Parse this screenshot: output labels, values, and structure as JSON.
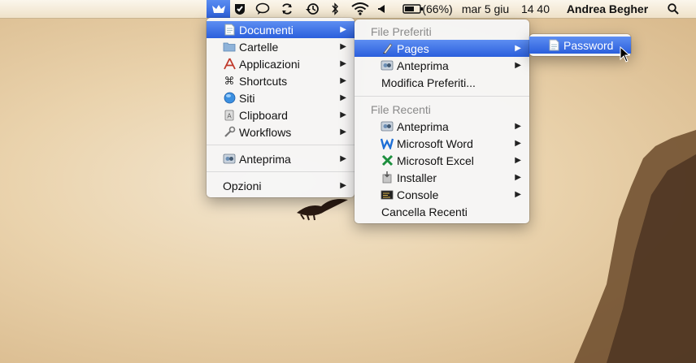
{
  "menubar": {
    "battery": "(66%)",
    "date": "mar 5 giu",
    "time": "14 40",
    "user": "Andrea Begher",
    "icons": [
      "app-launcher-icon",
      "checkmark-shield-icon",
      "chat-bubble-icon",
      "sync-icon",
      "time-machine-icon",
      "bluetooth-icon",
      "wifi-icon",
      "volume-icon",
      "battery-icon",
      "spotlight-search-icon"
    ]
  },
  "menu1": {
    "items": [
      {
        "label": "Documenti",
        "icon": "document-icon"
      },
      {
        "label": "Cartelle",
        "icon": "folder-icon"
      },
      {
        "label": "Applicazioni",
        "icon": "applications-icon"
      },
      {
        "label": "Shortcuts",
        "icon": "command-icon"
      },
      {
        "label": "Siti",
        "icon": "globe-icon"
      },
      {
        "label": "Clipboard",
        "icon": "clipboard-icon"
      },
      {
        "label": "Workflows",
        "icon": "wrench-icon"
      }
    ],
    "preview": "Anteprima",
    "options": "Opzioni"
  },
  "menu2": {
    "favorites_header": "File Preferiti",
    "favorites": [
      {
        "label": "Pages",
        "icon": "pages-icon"
      },
      {
        "label": "Anteprima",
        "icon": "preview-icon"
      }
    ],
    "edit_favorites": "Modifica Preferiti...",
    "recent_header": "File Recenti",
    "recent": [
      {
        "label": "Anteprima",
        "icon": "preview-icon"
      },
      {
        "label": "Microsoft Word",
        "icon": "word-icon"
      },
      {
        "label": "Microsoft Excel",
        "icon": "excel-icon"
      },
      {
        "label": "Installer",
        "icon": "installer-icon"
      },
      {
        "label": "Console",
        "icon": "console-icon"
      }
    ],
    "clear_recent": "Cancella Recenti"
  },
  "menu3": {
    "items": [
      {
        "label": "Password",
        "icon": "pages-document-icon"
      }
    ]
  },
  "colors": {
    "selection": "#2f62dd",
    "menu_bg": "#f6f6f6",
    "header_text": "#8a8a8a"
  }
}
